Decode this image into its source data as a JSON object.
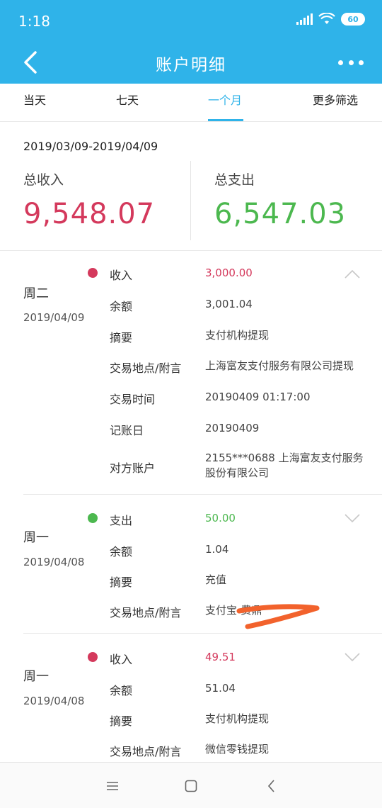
{
  "status_bar": {
    "time": "1:18",
    "battery": "60",
    "icons": [
      "signal-icon",
      "wifi-icon",
      "battery-icon"
    ]
  },
  "header": {
    "title": "账户明细",
    "back_icon": "chevron-left-icon",
    "more_icon": "more-dots-icon"
  },
  "tabs": [
    {
      "label": "当天"
    },
    {
      "label": "七天"
    },
    {
      "label": "一个月",
      "active": true
    },
    {
      "label": "更多筛选"
    }
  ],
  "summary": {
    "range": "2019/03/09-2019/04/09",
    "income_label": "总收入",
    "income_value": "9,548.07",
    "expense_label": "总支出",
    "expense_value": "6,547.03"
  },
  "records": [
    {
      "weekday": "周二",
      "date": "2019/04/09",
      "type": "income",
      "expanded": true,
      "rows": [
        {
          "key": "收入",
          "value": "3,000.00"
        },
        {
          "key": "余额",
          "value": "3,001.04"
        },
        {
          "key": "摘要",
          "value": "支付机构提现"
        },
        {
          "key": "交易地点/附言",
          "value": "上海富友支付服务有限公司提现"
        },
        {
          "key": "交易时间",
          "value": "20190409 01:17:00"
        },
        {
          "key": "记账日",
          "value": "20190409"
        },
        {
          "key": "对方账户",
          "value": "2155***0688 上海富友支付服务股份有限公司"
        }
      ]
    },
    {
      "weekday": "周一",
      "date": "2019/04/08",
      "type": "expense",
      "expanded": false,
      "rows": [
        {
          "key": "支出",
          "value": "50.00"
        },
        {
          "key": "余额",
          "value": "1.04"
        },
        {
          "key": "摘要",
          "value": "充值"
        },
        {
          "key": "交易地点/附言",
          "value": "支付宝-费鼎"
        }
      ]
    },
    {
      "weekday": "周一",
      "date": "2019/04/08",
      "type": "income",
      "expanded": false,
      "rows": [
        {
          "key": "收入",
          "value": "49.51"
        },
        {
          "key": "余额",
          "value": "51.04"
        },
        {
          "key": "摘要",
          "value": "支付机构提现"
        },
        {
          "key": "交易地点/附言",
          "value": "微信零钱提现"
        }
      ]
    }
  ],
  "colors": {
    "brand": "#2fb3e9",
    "income": "#d4395c",
    "expense": "#4cb84f",
    "scribble": "#f2622c"
  },
  "bottom_nav": {
    "icons": [
      "menu-icon",
      "home-square-icon",
      "back-triangle-icon"
    ]
  }
}
